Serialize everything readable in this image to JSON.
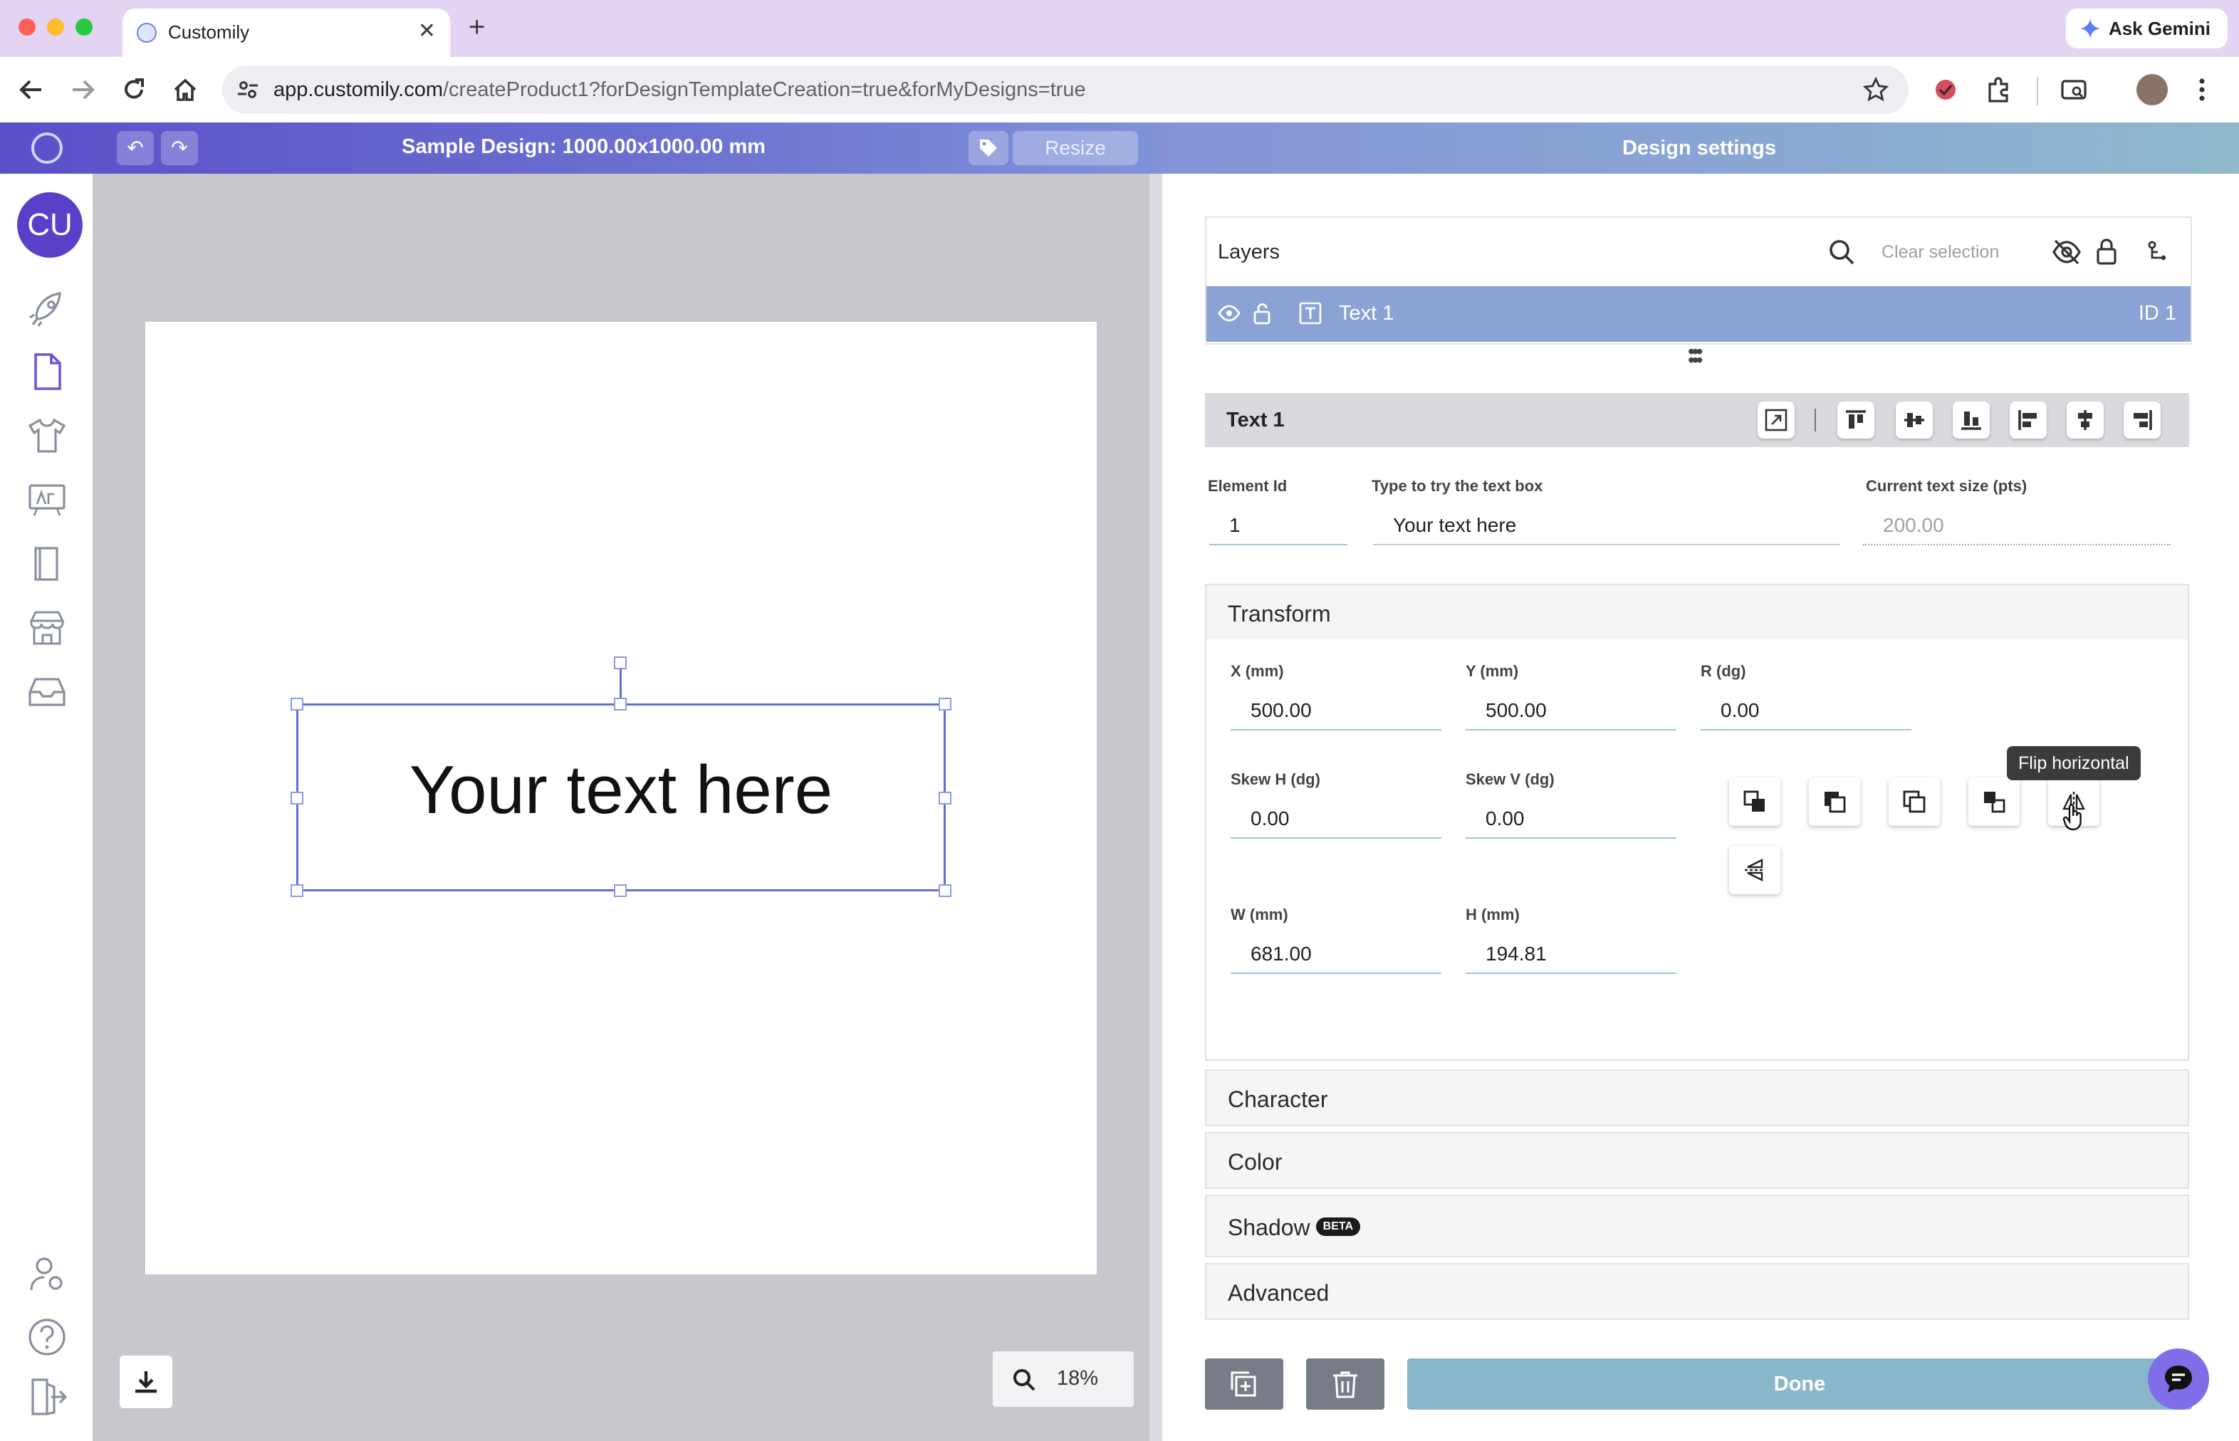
{
  "browser": {
    "tab_title": "Customily",
    "url_host": "app.customily.com",
    "url_path": "/createProduct1?forDesignTemplateCreation=true&forMyDesigns=true",
    "gemini_label": "Ask Gemini"
  },
  "app": {
    "design_title": "Sample Design: 1000.00x1000.00 mm",
    "resize_label": "Resize",
    "settings_title": "Design settings",
    "avatar_initials": "CU"
  },
  "canvas": {
    "text": "Your text here",
    "zoom": "18%"
  },
  "layers": {
    "header": "Layers",
    "clear_selection": "Clear selection",
    "rows": [
      {
        "name": "Text 1",
        "id": "ID 1"
      }
    ]
  },
  "element": {
    "title": "Text 1",
    "id_label": "Element Id",
    "id_value": "1",
    "text_label": "Type to try the text box",
    "text_value": "Your text here",
    "size_label": "Current text size (pts)",
    "size_value": "200.00"
  },
  "transform": {
    "title": "Transform",
    "x_label": "X (mm)",
    "x": "500.00",
    "y_label": "Y (mm)",
    "y": "500.00",
    "r_label": "R (dg)",
    "r": "0.00",
    "skewh_label": "Skew H (dg)",
    "skewh": "0.00",
    "skewv_label": "Skew V (dg)",
    "skewv": "0.00",
    "w_label": "W (mm)",
    "w": "681.00",
    "h_label": "H (mm)",
    "h": "194.81",
    "tooltip": "Flip horizontal"
  },
  "sections": {
    "character": "Character",
    "color": "Color",
    "shadow": "Shadow",
    "shadow_badge": "BETA",
    "advanced": "Advanced"
  },
  "footer": {
    "done_label": "Done"
  },
  "colors": {
    "accent_purple": "#5b4fc9",
    "selected_layer": "#8aa3d4",
    "done_button": "#8ab6c9"
  }
}
